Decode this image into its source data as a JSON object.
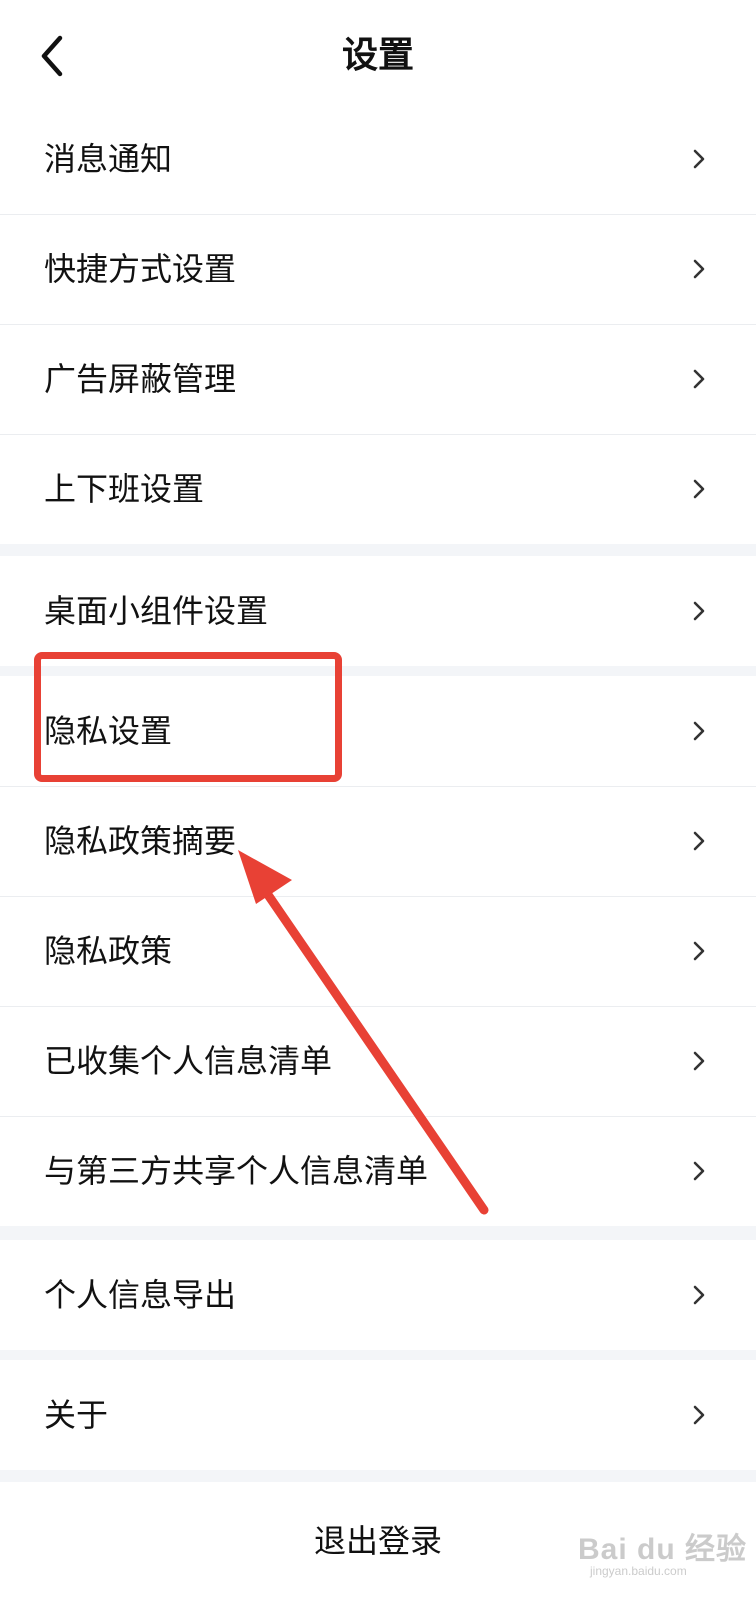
{
  "header": {
    "title": "设置",
    "back_icon": "chevron-left-icon"
  },
  "groups": [
    {
      "items": [
        {
          "label": "消息通知"
        },
        {
          "label": "快捷方式设置"
        },
        {
          "label": "广告屏蔽管理"
        },
        {
          "label": "上下班设置"
        }
      ]
    },
    {
      "items": [
        {
          "label": "桌面小组件设置"
        }
      ]
    },
    {
      "items": [
        {
          "label": "隐私设置"
        },
        {
          "label": "隐私政策摘要"
        },
        {
          "label": "隐私政策"
        },
        {
          "label": "已收集个人信息清单"
        },
        {
          "label": "与第三方共享个人信息清单"
        }
      ]
    },
    {
      "items": [
        {
          "label": "个人信息导出"
        }
      ]
    },
    {
      "items": [
        {
          "label": "关于"
        }
      ]
    }
  ],
  "logout": {
    "label": "退出登录"
  },
  "annotation": {
    "color": "#e84135",
    "highlighted_item": "隐私设置"
  },
  "watermark": {
    "text": "Bai du 经验",
    "subtext": "jingyan.baidu.com"
  },
  "colors": {
    "background": "#f3f5f8",
    "surface": "#ffffff",
    "divider": "#ebedf0",
    "text": "#111111",
    "chevron": "#333333"
  }
}
